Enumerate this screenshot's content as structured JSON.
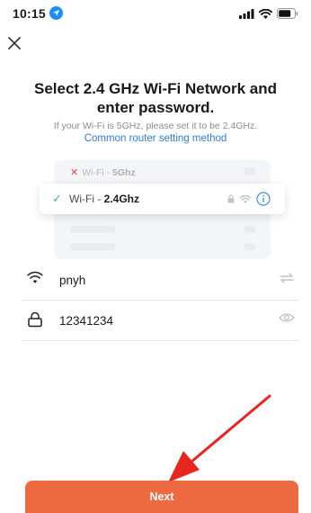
{
  "status_bar": {
    "time": "10:15",
    "location_icon": "location-arrow-icon",
    "signal_icon": "cell-signal-icon",
    "wifi_icon": "wifi-icon",
    "battery_icon": "battery-icon"
  },
  "header": {
    "close_icon": "close-icon"
  },
  "title": "Select 2.4 GHz Wi-Fi Network and enter password.",
  "subtitle": "If your Wi-Fi is 5GHz, please set it to be 2.4GHz.",
  "help_link": "Common router setting method",
  "illustration": {
    "band_5g": {
      "prefix": "Wi-Fi - ",
      "band": "5Ghz",
      "status_icon": "x-icon"
    },
    "band_24g": {
      "prefix": "Wi-Fi - ",
      "band": "2.4Ghz",
      "status_icon": "check-icon",
      "icons": [
        "lock-icon",
        "wifi-icon",
        "info-icon"
      ]
    }
  },
  "form": {
    "ssid": {
      "value": "pnyh",
      "icon": "wifi-icon",
      "action_icon": "switch-network-icon"
    },
    "password": {
      "value": "12341234",
      "icon": "lock-icon",
      "action_icon": "eye-icon"
    }
  },
  "next_button": {
    "label": "Next"
  },
  "colors": {
    "accent": "#ee6a40",
    "link": "#2d7be0",
    "arrow": "#e8261f",
    "check": "#3fb27f"
  }
}
